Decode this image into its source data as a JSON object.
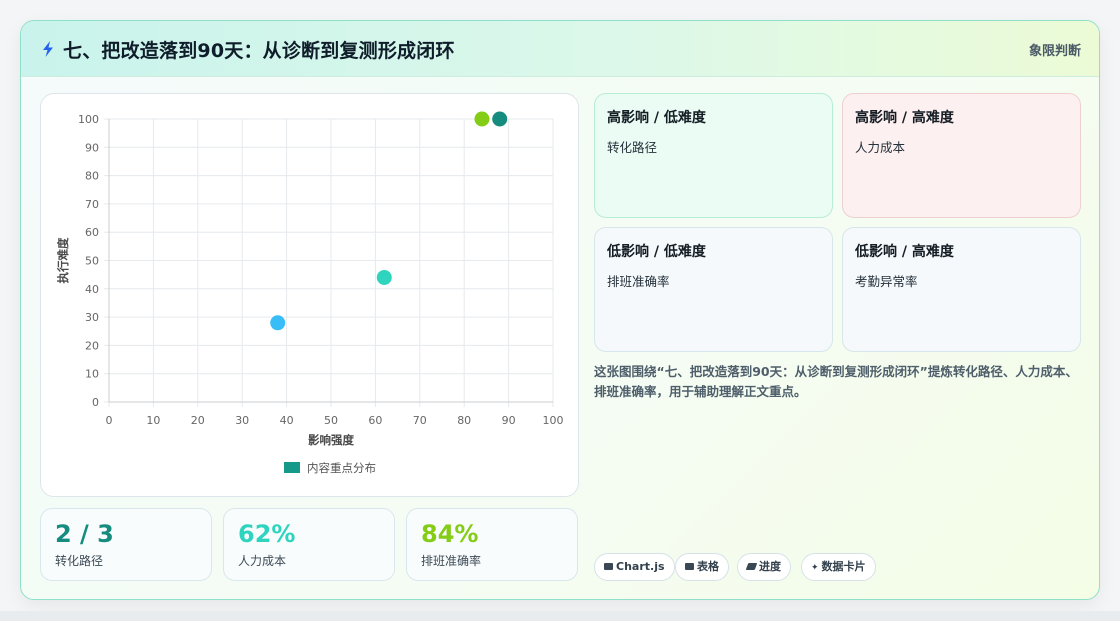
{
  "header": {
    "title": "七、把改造落到90天：从诊断到复测形成闭环",
    "tag": "象限判断",
    "icon": "lightning-icon"
  },
  "chart_data": {
    "type": "scatter",
    "xlabel": "影响强度",
    "ylabel": "执行难度",
    "xlim": [
      0,
      100
    ],
    "ylim": [
      0,
      100
    ],
    "xticks": [
      0,
      10,
      20,
      30,
      40,
      50,
      60,
      70,
      80,
      90,
      100
    ],
    "yticks": [
      0,
      10,
      20,
      30,
      40,
      50,
      60,
      70,
      80,
      90,
      100
    ],
    "grid": true,
    "legend_position": "bottom",
    "legend_color": "#159a8a",
    "series": [
      {
        "name": "内容重点分布",
        "points": [
          {
            "x": 38,
            "y": 28,
            "color": "#38bdf8"
          },
          {
            "x": 62,
            "y": 44,
            "color": "#2fd4bf"
          },
          {
            "x": 84,
            "y": 100,
            "color": "#84cc16"
          },
          {
            "x": 88,
            "y": 100,
            "color": "#168c7e"
          }
        ]
      }
    ]
  },
  "quadrants": [
    {
      "title": "高影响 / 低难度",
      "item": "转化路径"
    },
    {
      "title": "高影响 / 高难度",
      "item": "人力成本"
    },
    {
      "title": "低影响 / 低难度",
      "item": "排班准确率"
    },
    {
      "title": "低影响 / 高难度",
      "item": "考勤异常率"
    }
  ],
  "summary": "这张图围绕“七、把改造落到90天：从诊断到复测形成闭环”提炼转化路径、人力成本、排班准确率，用于辅助理解正文重点。",
  "kpis": [
    {
      "value": "2 / 3",
      "label": "转化路径",
      "color": "#168c7e"
    },
    {
      "value": "62%",
      "label": "人力成本",
      "color": "#2fd4bf"
    },
    {
      "value": "84%",
      "label": "排班准确率",
      "color": "#84cc16"
    }
  ],
  "pills": [
    {
      "label": "Chart.js",
      "icon": "chart-icon"
    },
    {
      "label": "表格",
      "icon": "table-icon"
    },
    {
      "label": "进度",
      "icon": "progress-icon"
    },
    {
      "label": "数据卡片",
      "icon": "sparkle-icon"
    }
  ]
}
